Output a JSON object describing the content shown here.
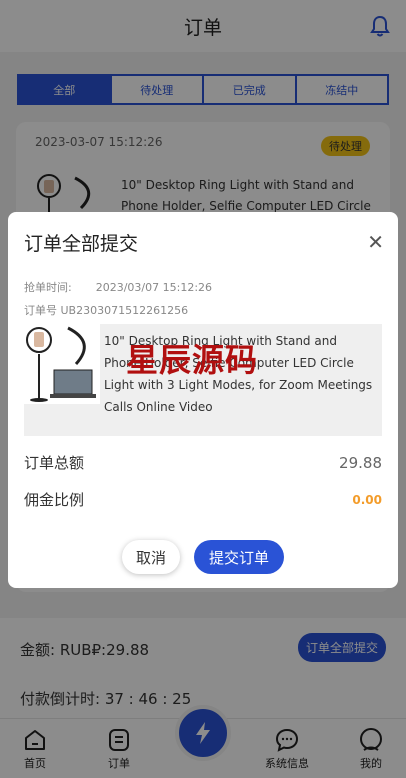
{
  "header": {
    "title": "订单"
  },
  "tabs": [
    {
      "label": "全部"
    },
    {
      "label": "待处理"
    },
    {
      "label": "已完成"
    },
    {
      "label": "冻结中"
    }
  ],
  "order_card": {
    "time": "2023-03-07 15:12:26",
    "badge": "待处理",
    "title": "10\" Desktop Ring Light with Stand and Phone Holder, Selfie Computer LED Circle"
  },
  "modal": {
    "title": "订单全部提交",
    "grab_time_label": "抢单时间:",
    "grab_time_value": "2023/03/07 15:12:26",
    "order_no": "订单号 UB2303071512261256",
    "product_title": "10\" Desktop Ring Light with Stand and Phone Holder, Selfie Computer LED Circle Light with 3 Light Modes, for Zoom Meetings Calls Online Video",
    "watermark": "星辰源码",
    "total_label": "订单总额",
    "total_value": "29.88",
    "rate_label": "佣金比例",
    "rate_value": "0.00",
    "cancel_label": "取消",
    "submit_label": "提交订单"
  },
  "bottom": {
    "amount": "金额:  RUB₽:29.88",
    "submit_all": "订单全部提交",
    "countdown": "付款倒计时:  37 : 46 : 25"
  },
  "tabbar": {
    "home": "首页",
    "orders": "订单",
    "sysinfo": "系统信息",
    "mine": "我的"
  },
  "colors": {
    "primary": "#2a53d6",
    "badge": "#f3c316",
    "watermark": "#b10f0f",
    "rate": "#f39c2a"
  }
}
